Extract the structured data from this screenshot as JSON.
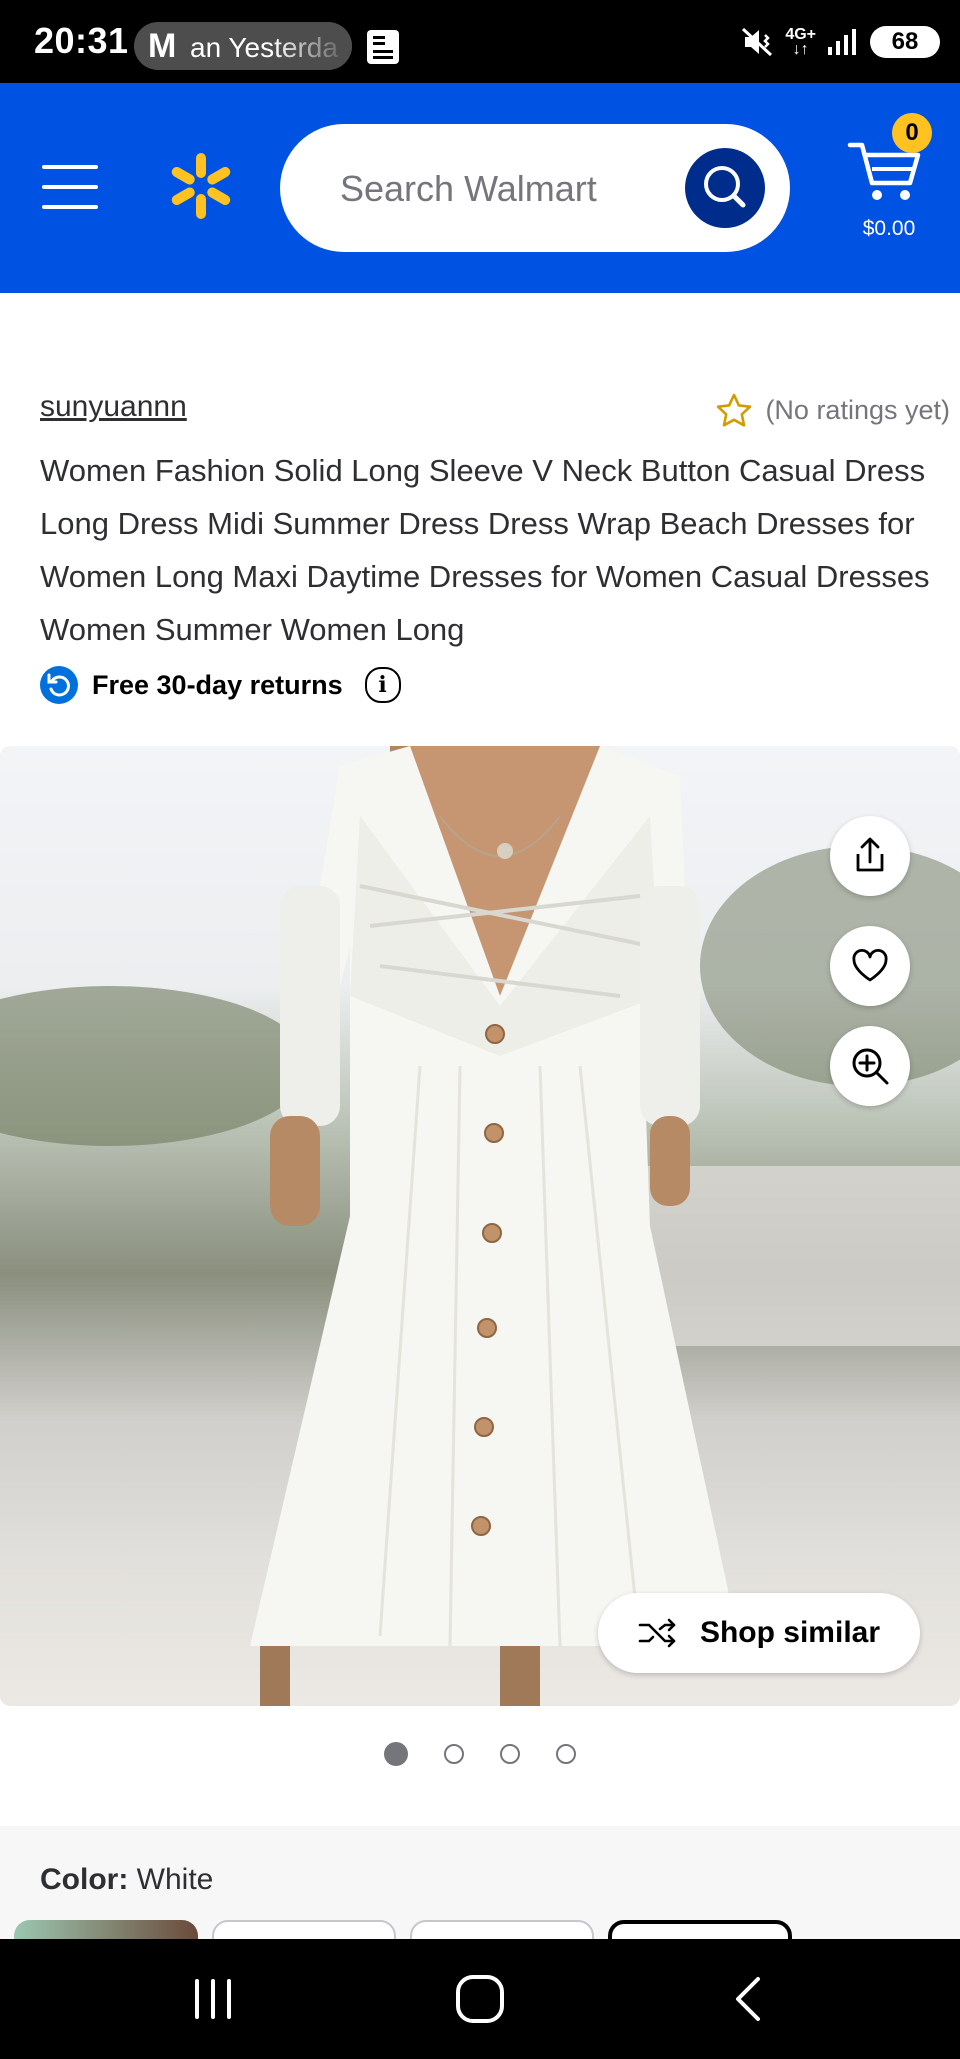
{
  "status_bar": {
    "time": "20:31",
    "notification_text": "an Yesterda",
    "notification_icon": "gmail-m-icon",
    "network": "4G+",
    "battery": "68"
  },
  "header": {
    "search_placeholder": "Search Walmart",
    "cart_count": "0",
    "cart_total": "$0.00",
    "brand_color": "#0053e2",
    "spark_color": "#ffc220"
  },
  "product": {
    "seller": "sunyuannn",
    "rating_text": "(No ratings yet)",
    "title": "Women Fashion Solid Long Sleeve V Neck Button Casual Dress Long Dress Midi Summer Dress Dress Wrap Beach Dresses for Women Long Maxi Daytime Dresses for Women Casual Dresses Women Summer Women Long",
    "returns_label": "Free 30-day returns"
  },
  "gallery": {
    "shop_similar_label": "Shop similar",
    "image_count": 4,
    "active_index": 0
  },
  "variants": {
    "color_label": "Color:",
    "color_value": "White"
  }
}
